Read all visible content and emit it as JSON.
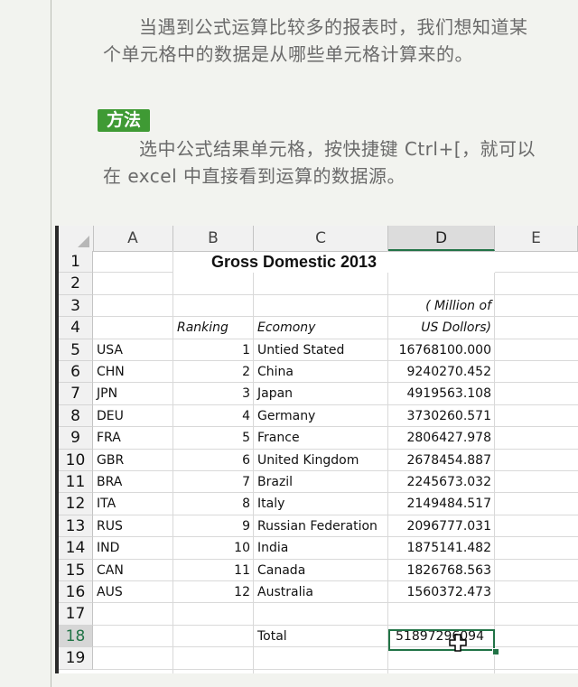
{
  "text": {
    "para1": "当遇到公式运算比较多的报表时，我们想知道某个单元格中的数据是从哪些单元格计算来的。",
    "method_label": "方法",
    "para2": "选中公式结果单元格，按快捷键 Ctrl+[，就可以在 excel 中直接看到运算的数据源。"
  },
  "sheet": {
    "columns": [
      "A",
      "B",
      "C",
      "D",
      "E"
    ],
    "selected_column": "D",
    "rows": [
      "1",
      "2",
      "3",
      "4",
      "5",
      "6",
      "7",
      "8",
      "9",
      "10",
      "11",
      "12",
      "13",
      "14",
      "15",
      "16",
      "17",
      "18",
      "19"
    ],
    "selected_row": "18",
    "title": "Gross Domestic 2013",
    "header_d3": "( Million of",
    "header_b4": "Ranking",
    "header_c4": "Ecomony",
    "header_d4": "US Dollors)",
    "data": [
      {
        "code": "USA",
        "rank": "1",
        "name": "Untied Stated",
        "gdp": "16768100.000"
      },
      {
        "code": "CHN",
        "rank": "2",
        "name": "China",
        "gdp": "9240270.452"
      },
      {
        "code": "JPN",
        "rank": "3",
        "name": "Japan",
        "gdp": "4919563.108"
      },
      {
        "code": "DEU",
        "rank": "4",
        "name": "Germany",
        "gdp": "3730260.571"
      },
      {
        "code": "FRA",
        "rank": "5",
        "name": "France",
        "gdp": "2806427.978"
      },
      {
        "code": "GBR",
        "rank": "6",
        "name": "United Kingdom",
        "gdp": "2678454.887"
      },
      {
        "code": "BRA",
        "rank": "7",
        "name": "Brazil",
        "gdp": "2245673.032"
      },
      {
        "code": "ITA",
        "rank": "8",
        "name": "Italy",
        "gdp": "2149484.517"
      },
      {
        "code": "RUS",
        "rank": "9",
        "name": "Russian Federation",
        "gdp": "2096777.031"
      },
      {
        "code": "IND",
        "rank": "10",
        "name": "India",
        "gdp": "1875141.482"
      },
      {
        "code": "CAN",
        "rank": "11",
        "name": "Canada",
        "gdp": "1826768.563"
      },
      {
        "code": "AUS",
        "rank": "12",
        "name": "Australia",
        "gdp": "1560372.473"
      }
    ],
    "total_label": "Total",
    "total_value": "51897296094",
    "colors": {
      "accent": "#217346",
      "method_badge": "#3f9a34"
    },
    "icons": {
      "cursor": "excel-cross-cursor-icon",
      "corner": "select-all-triangle-icon"
    }
  }
}
